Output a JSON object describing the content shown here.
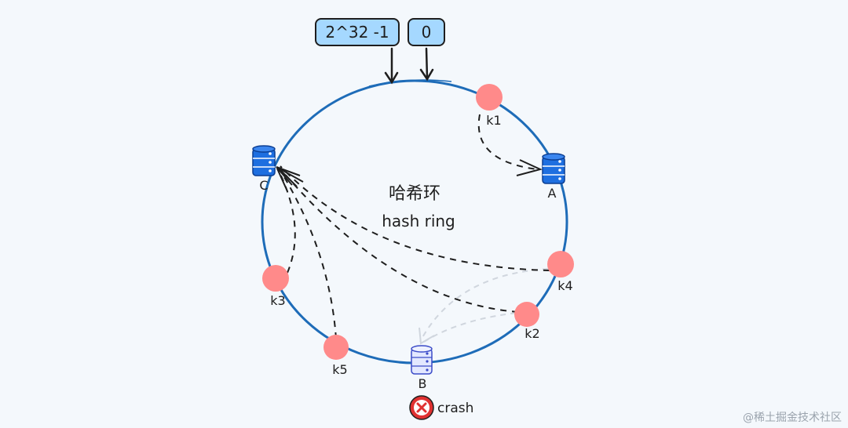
{
  "ring": {
    "title": "哈希环",
    "subtitle": "hash ring",
    "max_label": "2^32 -1",
    "zero_label": "0"
  },
  "servers": [
    {
      "id": "server-a",
      "label": "A",
      "color": "#1e6fe0",
      "status": "active"
    },
    {
      "id": "server-b",
      "label": "B",
      "color": "#9aa6f2",
      "status": "crashed"
    },
    {
      "id": "server-c",
      "label": "C",
      "color": "#1e6fe0",
      "status": "active"
    }
  ],
  "keys": [
    {
      "id": "k1",
      "label": "k1"
    },
    {
      "id": "k2",
      "label": "k2"
    },
    {
      "id": "k3",
      "label": "k3"
    },
    {
      "id": "k4",
      "label": "k4"
    },
    {
      "id": "k5",
      "label": "k5"
    }
  ],
  "crash": {
    "label": "crash",
    "icon": "close-circle-icon"
  },
  "watermark": "@稀土掘金技术社区",
  "colors": {
    "ring": "#1e6cb8",
    "key_node": "#ff8a8a",
    "box_fill": "#a5d8ff",
    "crash_red": "#e03131",
    "ghost_arrow": "#d0d6de"
  }
}
